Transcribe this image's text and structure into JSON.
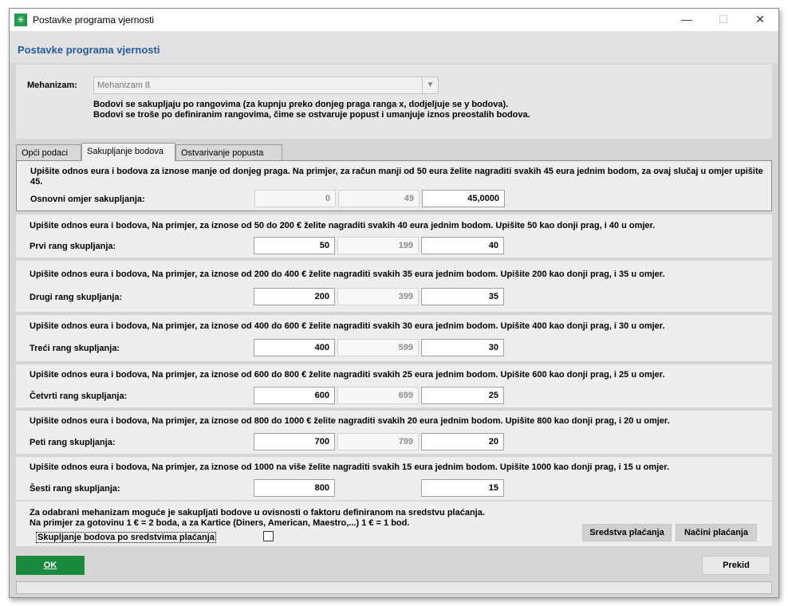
{
  "window": {
    "title": "Postavke programa vjernosti"
  },
  "header": {
    "title": "Postavke programa vjernosti"
  },
  "mechanism": {
    "label": "Mehanizam:",
    "value": "Mehanizam 8",
    "desc1": "Bodovi se sakupljaju po rangovima (za kupnju preko donjeg praga ranga x, dodjeljuje se y bodova).",
    "desc2": "Bodovi se troše po definiranim rangovima, čime se ostvaruje popust i umanjuje iznos preostalih bodova."
  },
  "tabs": [
    "Opći podaci",
    "Sakupljanje bodova",
    "Ostvarivanje popusta"
  ],
  "ranges": [
    {
      "desc": "Upišite odnos eura i bodova za iznose manje od donjeg praga. Na primjer, za račun manji od 50 eura želite nagraditi svakih 45 eura jednim bodom, za ovaj slučaj u omjer upišite 45.",
      "label": "Osnovni omjer sakupljanja:",
      "from": "0",
      "to": "49",
      "ratio": "45,0000"
    },
    {
      "desc": "Upišite odnos eura i bodova, Na primjer, za iznose od 50 do 200 € želite nagraditi svakih 40 eura jednim bodom. Upišite 50 kao donji prag, i 40 u omjer.",
      "label": "Prvi rang skupljanja:",
      "from": "50",
      "to": "199",
      "ratio": "40"
    },
    {
      "desc": "Upišite odnos eura i bodova, Na primjer, za iznose od 200 do 400 € želite nagraditi svakih 35 eura jednim bodom. Upišite 200 kao donji prag, i 35 u omjer.",
      "label": "Drugi rang skupljanja:",
      "from": "200",
      "to": "399",
      "ratio": "35"
    },
    {
      "desc": "Upišite odnos eura i bodova, Na primjer, za iznose od 400 do 600 € želite nagraditi svakih 30 eura jednim bodom. Upišite 400 kao donji prag, i 30 u omjer.",
      "label": "Treći rang skupljanja:",
      "from": "400",
      "to": "599",
      "ratio": "30"
    },
    {
      "desc": "Upišite odnos eura i bodova, Na primjer, za iznose od 600 do 800 € želite nagraditi svakih 25 eura jednim bodom. Upišite 600 kao donji prag, i 25 u omjer.",
      "label": "Četvrti rang skupljanja:",
      "from": "600",
      "to": "699",
      "ratio": "25"
    },
    {
      "desc": "Upišite odnos eura i bodova, Na primjer, za iznose od 800 do 1000 € želite nagraditi svakih 20 eura jednim bodom. Upišite 800 kao donji prag, i 20 u omjer.",
      "label": "Peti rang skupljanja:",
      "from": "700",
      "to": "799",
      "ratio": "20"
    },
    {
      "desc": "Upišite odnos eura i bodova, Na primjer, za iznose od 1000 na više želite nagraditi svakih 15 eura jednim bodom. Upišite 1000 kao donji prag, i 15 u omjer.",
      "label": "Šesti rang skupljanja:",
      "from": "800",
      "to": null,
      "ratio": "15"
    }
  ],
  "payment": {
    "desc1": "Za odabrani mehanizam moguće je sakupljati bodove u ovisnosti o faktoru definiranom na sredstvu plaćanja.",
    "desc2": "Na primjer za gotovinu 1 € = 2 boda, a za Kartice (Diners, American, Maestro,...) 1 € = 1 bod.",
    "checkbox_label": "Skupljanje bodova po sredstvima plaćanja",
    "means_button": "Sredstva plaćanja",
    "methods_button": "Načini plaćanja"
  },
  "footer": {
    "ok": "OK",
    "cancel": "Prekid"
  }
}
